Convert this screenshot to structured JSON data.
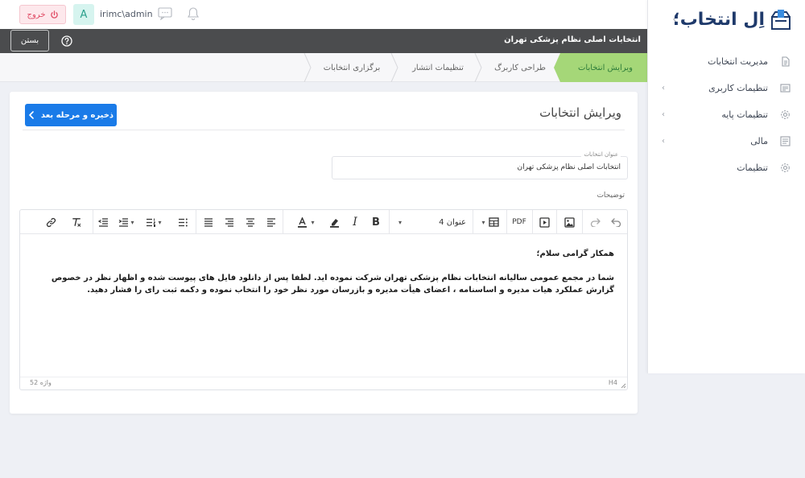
{
  "brand": {
    "name": "اِل انتخاب؛"
  },
  "sidebar": {
    "items": [
      {
        "label": "مدیریت انتخابات",
        "icon": "document-icon",
        "has_children": false
      },
      {
        "label": "تنظیمات کاربری",
        "icon": "user-card-icon",
        "has_children": true
      },
      {
        "label": "تنظیمات پایه",
        "icon": "gear-icon",
        "has_children": true
      },
      {
        "label": "مالی",
        "icon": "invoice-icon",
        "has_children": true
      },
      {
        "label": "تنظیمات",
        "icon": "gear-icon",
        "has_children": false
      }
    ]
  },
  "topbar": {
    "logout_label": "خروج",
    "avatar_letter": "A",
    "username": "irimc\\admin"
  },
  "titlebar": {
    "close_label": "بستن",
    "title": "انتخابات اصلی نظام پزشکی تهران"
  },
  "steps": [
    {
      "label": "ویرایش انتخابات",
      "active": true
    },
    {
      "label": "طراحی کاربرگ",
      "active": false
    },
    {
      "label": "تنظیمات انتشار",
      "active": false
    },
    {
      "label": "برگزاری انتخابات",
      "active": false
    }
  ],
  "card": {
    "title": "ویرایش انتخابات",
    "save_label": "ذخیره و مرحله بعد",
    "title_field": {
      "label": "عنوان انتخابات",
      "value": "انتخابات اصلی نظام پزشکی تهران"
    },
    "description_label": "توضیحات"
  },
  "editor": {
    "heading_select": "عنوان 4",
    "pdf_label": "PDF",
    "content": {
      "greeting": "همکار گرامی سلام؛",
      "paragraph": "شما در مجمع عمومی سالیانه انتخابات نظام پزشکی تهران شرکت نموده اید. لطفا پس از دانلود فایل های پیوست شده و اظهار نظر در خصوص گزارش عملکرد هیات مدیره و اساسنامه ، اعضای هیأت مدیره و بازرسان مورد نظر خود را انتخاب نموده و دکمه ثبت رای را فشار دهید."
    },
    "word_count": "52 واژه",
    "path": "H4"
  },
  "colors": {
    "accent_blue": "#1a7be8",
    "step_active": "#a5d778",
    "logout_red": "#e04a64",
    "dark_bar": "#4b4c4e",
    "brand_navy": "#1f3a6b"
  }
}
